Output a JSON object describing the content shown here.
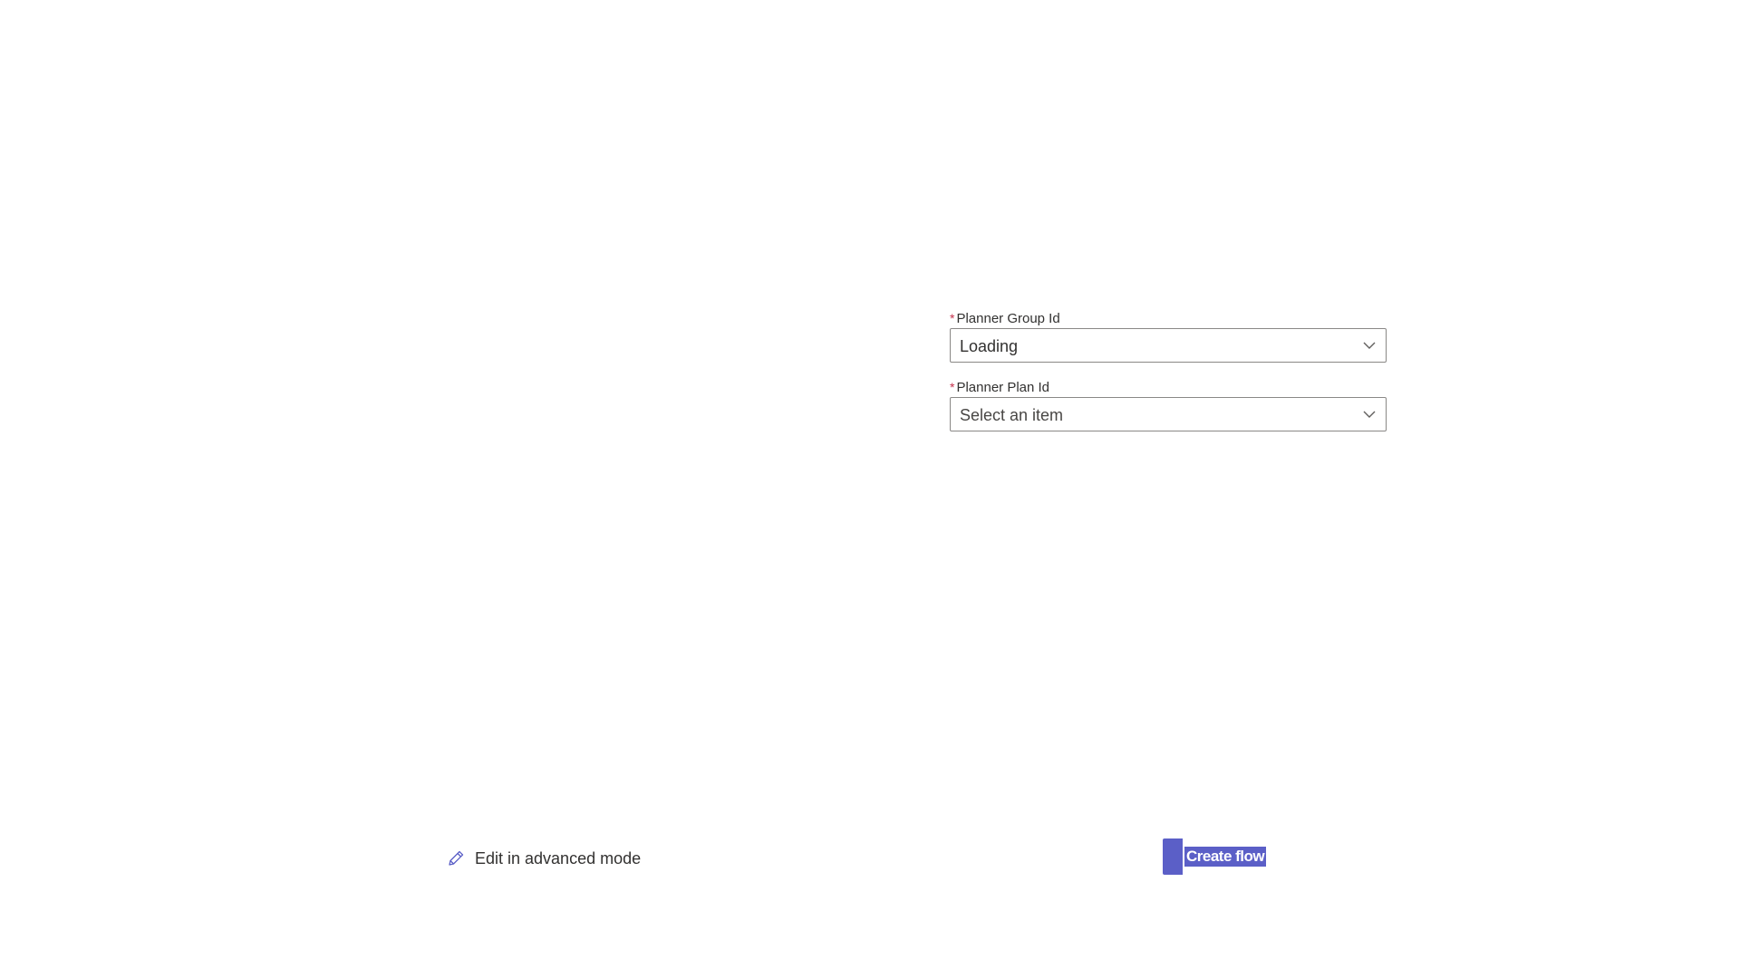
{
  "form": {
    "group_field": {
      "required_mark": "*",
      "label": "Planner Group Id",
      "value": "Loading"
    },
    "plan_field": {
      "required_mark": "*",
      "label": "Planner Plan Id",
      "placeholder": "Select an item"
    }
  },
  "footer": {
    "edit_label": "Edit in advanced mode",
    "create_label": "Create flow"
  },
  "icons": {
    "dropdown_chevron": "chevron-down-icon",
    "edit": "pencil-icon"
  },
  "colors": {
    "accent": "#5b5fc7",
    "required": "#c4314b",
    "text": "#323130",
    "border": "#8a8886"
  }
}
